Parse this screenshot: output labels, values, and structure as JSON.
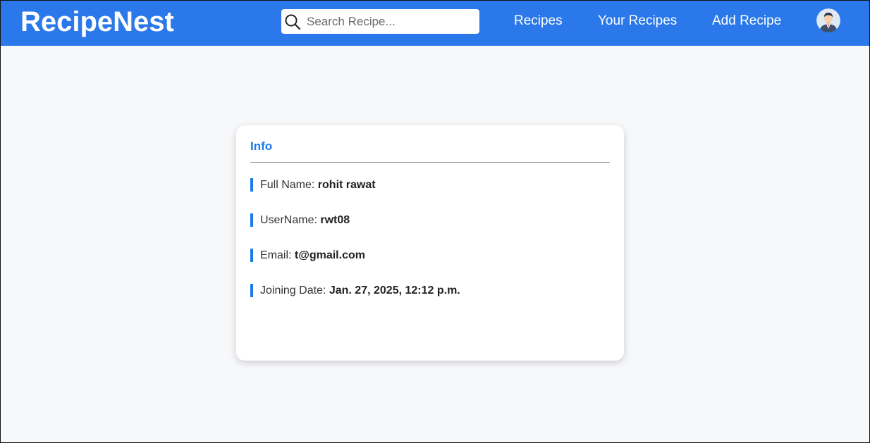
{
  "header": {
    "brand": "RecipeNest",
    "search": {
      "placeholder": "Search Recipe...",
      "value": "",
      "icon": "search-icon"
    },
    "nav": {
      "recipes": "Recipes",
      "your_recipes": "Your Recipes",
      "add_recipe": "Add Recipe"
    },
    "avatar_icon": "user-avatar-icon"
  },
  "info_card": {
    "title": "Info",
    "rows": [
      {
        "label": "Full Name: ",
        "value": "rohit rawat"
      },
      {
        "label": "UserName: ",
        "value": "rwt08"
      },
      {
        "label": "Email: ",
        "value": "t@gmail.com"
      },
      {
        "label": "Joining Date: ",
        "value": "Jan. 27, 2025, 12:12 p.m."
      }
    ]
  },
  "colors": {
    "navbar": "#2a78ea",
    "accent": "#1a7ae8",
    "page_background": "#f7f8fa",
    "card_background": "#ffffff"
  }
}
